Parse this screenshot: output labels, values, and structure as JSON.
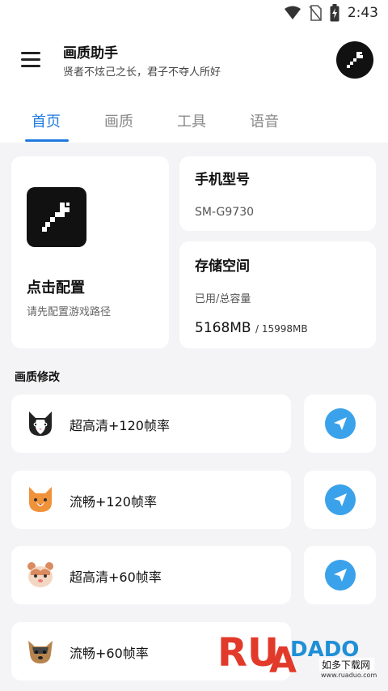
{
  "status": {
    "time": "2:43",
    "icons": [
      "wifi-icon",
      "no-sim-icon",
      "battery-charging-icon"
    ]
  },
  "header": {
    "menu_icon": "hamburger-menu-icon",
    "title": "画质助手",
    "subtitle": "贤者不炫己之长，君子不夺人所好",
    "avatar_icon": "wrench-icon"
  },
  "tabs": [
    {
      "label": "首页",
      "active": true
    },
    {
      "label": "画质",
      "active": false
    },
    {
      "label": "工具",
      "active": false
    },
    {
      "label": "语音",
      "active": false
    }
  ],
  "config": {
    "title": "点击配置",
    "subtitle": "请先配置游戏路径",
    "icon": "pixel-wrench-icon"
  },
  "model": {
    "title": "手机型号",
    "value": "SM-G9730"
  },
  "storage": {
    "title": "存储空间",
    "label": "已用/总容量",
    "used": "5168MB",
    "total": "/ 15998MB"
  },
  "section_title": "画质修改",
  "modifications": [
    {
      "label": "超高清+120帧率",
      "pet_icon": "black-white-cat-icon"
    },
    {
      "label": "流畅+120帧率",
      "pet_icon": "orange-cat-icon"
    },
    {
      "label": "超高清+60帧率",
      "pet_icon": "hamster-icon"
    },
    {
      "label": "流畅+60帧率",
      "pet_icon": "yorkie-dog-icon"
    }
  ],
  "send_icon": "paper-plane-icon",
  "watermark": {
    "brand": "RUANDADO",
    "caption": "如多下载网",
    "url": "www.ruaduo.com"
  },
  "colors": {
    "accent": "#1f7ae0",
    "send": "#3aa2ea",
    "background": "#f4f4f6",
    "watermark_red": "#e23a2a"
  }
}
